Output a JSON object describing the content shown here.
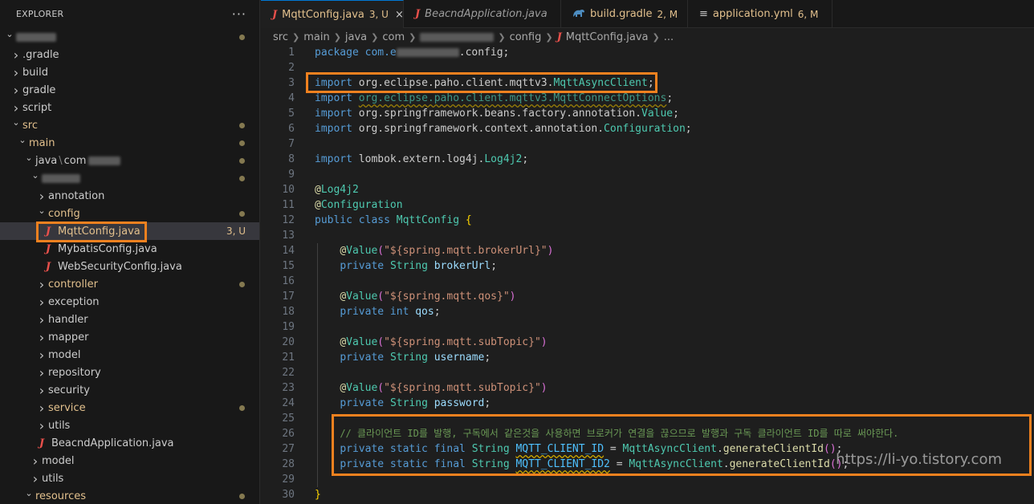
{
  "sidebar": {
    "title": "EXPLORER",
    "more": "···",
    "tree": [
      {
        "label": "",
        "blurred": true,
        "indent": 0,
        "chev": "v"
      },
      {
        "label": ".gradle",
        "indent": 1,
        "chev": ">"
      },
      {
        "label": "build",
        "indent": 1,
        "chev": ">"
      },
      {
        "label": "gradle",
        "indent": 1,
        "chev": ">"
      },
      {
        "label": "script",
        "indent": 1,
        "chev": ">"
      },
      {
        "label": "src",
        "indent": 1,
        "chev": "v",
        "git": true
      },
      {
        "label": "main",
        "indent": 2,
        "chev": "v",
        "git": true
      },
      {
        "label": "java",
        "sep": "\\",
        "label2": "com",
        "indent": 3,
        "chev": "v"
      },
      {
        "label": "",
        "blurred": true,
        "indent": 4,
        "chev": "v"
      },
      {
        "label": "annotation",
        "indent": 5,
        "chev": ">"
      },
      {
        "label": "config",
        "indent": 5,
        "chev": "v",
        "git": true
      },
      {
        "label": "MqttConfig.java",
        "indent": 5,
        "java": true,
        "badge": "3, U",
        "selected": true
      },
      {
        "label": "MybatisConfig.java",
        "indent": 5,
        "java": true
      },
      {
        "label": "WebSecurityConfig.java",
        "indent": 5,
        "java": true
      },
      {
        "label": "controller",
        "indent": 5,
        "chev": ">",
        "git": true
      },
      {
        "label": "exception",
        "indent": 5,
        "chev": ">"
      },
      {
        "label": "handler",
        "indent": 5,
        "chev": ">"
      },
      {
        "label": "mapper",
        "indent": 5,
        "chev": ">"
      },
      {
        "label": "model",
        "indent": 5,
        "chev": ">"
      },
      {
        "label": "repository",
        "indent": 5,
        "chev": ">"
      },
      {
        "label": "security",
        "indent": 5,
        "chev": ">"
      },
      {
        "label": "service",
        "indent": 5,
        "chev": ">",
        "git": true
      },
      {
        "label": "utils",
        "indent": 5,
        "chev": ">"
      },
      {
        "label": "BeacndApplication.java",
        "indent": 4,
        "java": true
      },
      {
        "label": "model",
        "indent": 4,
        "chev": ">"
      },
      {
        "label": "utils",
        "indent": 4,
        "chev": ">"
      },
      {
        "label": "resources",
        "indent": 3,
        "chev": "v",
        "git": true
      }
    ]
  },
  "tabs": [
    {
      "name": "MqttConfig.java",
      "state": "3, U",
      "icon": "J",
      "active": true,
      "close": "×"
    },
    {
      "name": "BeacndApplication.java",
      "icon": "J",
      "italic": true
    },
    {
      "name": "build.gradle",
      "state": "2, M",
      "icon": "gradle-icon"
    },
    {
      "name": "application.yml",
      "state": "6, M",
      "icon": "≡",
      "modified": true
    }
  ],
  "breadcrumb": {
    "items": [
      "src",
      "main",
      "java",
      "com",
      "",
      "config"
    ],
    "file": "MqttConfig.java",
    "tail": "..."
  },
  "code": {
    "lines": [
      {
        "n": "1"
      },
      {
        "n": "2"
      },
      {
        "n": "3"
      },
      {
        "n": "4"
      },
      {
        "n": "5"
      },
      {
        "n": "6"
      },
      {
        "n": "7"
      },
      {
        "n": "8"
      },
      {
        "n": "9"
      },
      {
        "n": "10"
      },
      {
        "n": "11"
      },
      {
        "n": "12"
      },
      {
        "n": "13"
      },
      {
        "n": "14"
      },
      {
        "n": "15"
      },
      {
        "n": "16"
      },
      {
        "n": "17"
      },
      {
        "n": "18"
      },
      {
        "n": "19"
      },
      {
        "n": "20"
      },
      {
        "n": "21"
      },
      {
        "n": "22"
      },
      {
        "n": "23"
      },
      {
        "n": "24"
      },
      {
        "n": "25"
      },
      {
        "n": "26"
      },
      {
        "n": "27"
      },
      {
        "n": "28"
      },
      {
        "n": "29"
      },
      {
        "n": "30"
      }
    ],
    "package_prefix": "package com.e",
    "package_suffix": ".config;",
    "import1_pkg": "org.eclipse.paho.client.mqttv3.",
    "import1_cls": "MqttAsyncClient",
    "import2_pkg": "org.eclipse.paho.client.mqttv3.MqttConnectOptions",
    "import3_pkg": "org.springframework.beans.factory.annotation.",
    "import3_cls": "Value",
    "import4_pkg": "org.springframework.context.annotation.",
    "import4_cls": "Configuration",
    "import5_pkg": "lombok.extern.log4j.",
    "import5_cls": "Log4j2",
    "ann_log": "Log4j2",
    "ann_conf": "Configuration",
    "class_name": "MqttConfig",
    "value1": "\"${spring.mqtt.brokerUrl}\"",
    "field1": "brokerUrl",
    "value2": "\"${spring.mqtt.qos}\"",
    "field2": "qos",
    "value3": "\"${spring.mqtt.subTopic}\"",
    "field3": "username",
    "value4": "\"${spring.mqtt.subTopic}\"",
    "field4": "password",
    "comment": "// 클라이언트 ID를 발행, 구독에서 같은것을 사용하면 브로커가 연결을 끊으므로 발행과 구독 클라이언트 ID를 따로 써야한다.",
    "const1": "MQTT_CLIENT_ID",
    "const2": "MQTT_CLIENT_ID2",
    "gen_cls": "MqttAsyncClient",
    "gen_fn": "generateClientId"
  },
  "watermark": "https://li-yo.tistory.com",
  "colors": {
    "highlight_box": "#f0811f",
    "git_modified": "#e2c08d"
  }
}
